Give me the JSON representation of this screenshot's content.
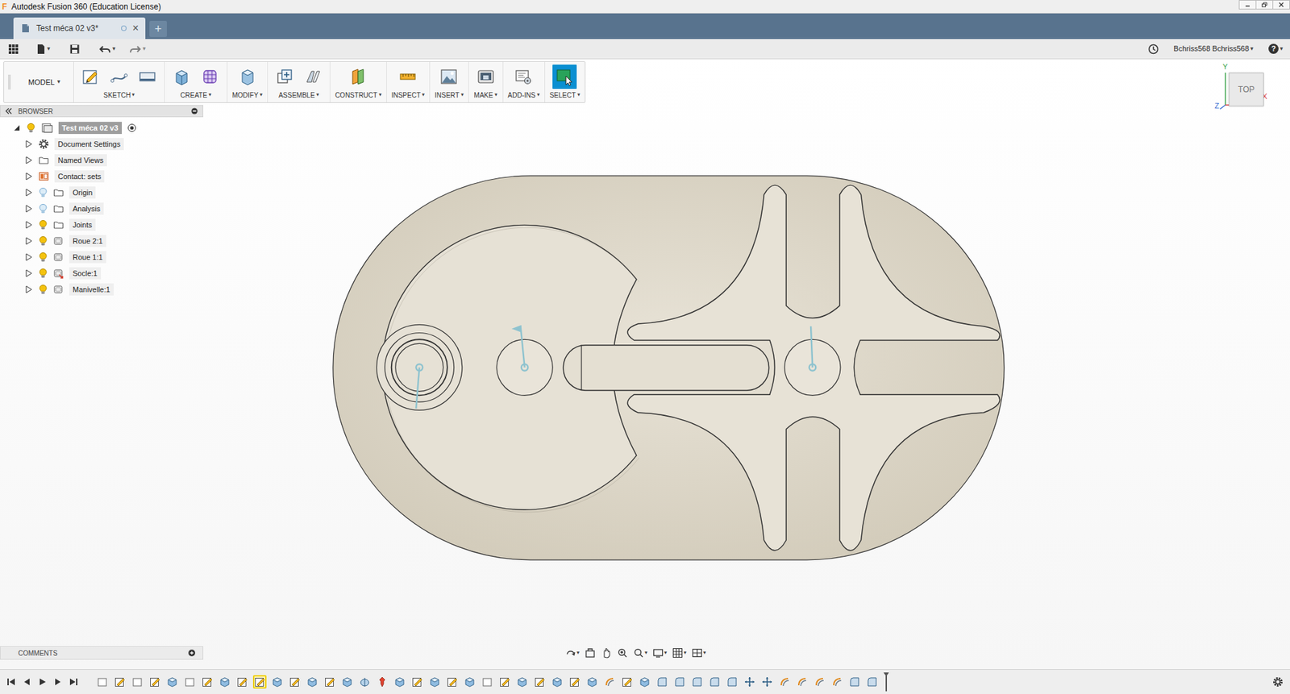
{
  "window": {
    "title": "Autodesk Fusion 360 (Education License)",
    "app_letter": "F"
  },
  "glyphs": {
    "dropdown": "▾"
  },
  "document_tab": {
    "label": "Test méca 02 v3*",
    "close": "×",
    "selected": true
  },
  "new_tab": "+",
  "quick_access": {
    "user": "Bchriss568 Bchriss568",
    "help": "?"
  },
  "toolbar": {
    "workspace": "MODEL",
    "groups": [
      {
        "label": "SKETCH",
        "selected": false
      },
      {
        "label": "CREATE",
        "selected": false
      },
      {
        "label": "MODIFY",
        "selected": false
      },
      {
        "label": "ASSEMBLE",
        "selected": false
      },
      {
        "label": "CONSTRUCT",
        "selected": false
      },
      {
        "label": "INSPECT",
        "selected": false
      },
      {
        "label": "INSERT",
        "selected": false
      },
      {
        "label": "MAKE",
        "selected": false
      },
      {
        "label": "ADD-INS",
        "selected": false
      },
      {
        "label": "SELECT",
        "selected": true
      }
    ]
  },
  "browser": {
    "header": "BROWSER",
    "items": [
      {
        "label": "Test méca 02 v3",
        "depth": 0,
        "expanded": true,
        "icon": "document",
        "bulb": "on",
        "selected": true,
        "active": true
      },
      {
        "label": "Document Settings",
        "depth": 1,
        "expanded": false,
        "icon": "settings",
        "bulb": "none",
        "selected": false,
        "active": false
      },
      {
        "label": "Named Views",
        "depth": 1,
        "expanded": false,
        "icon": "folder",
        "bulb": "none",
        "selected": false,
        "active": false
      },
      {
        "label": "Contact: sets",
        "depth": 1,
        "expanded": false,
        "icon": "contact",
        "bulb": "none",
        "selected": false,
        "active": false
      },
      {
        "label": "Origin",
        "depth": 1,
        "expanded": false,
        "icon": "folder",
        "bulb": "off",
        "selected": false,
        "active": false
      },
      {
        "label": "Analysis",
        "depth": 1,
        "expanded": false,
        "icon": "folder",
        "bulb": "off",
        "selected": false,
        "active": false
      },
      {
        "label": "Joints",
        "depth": 1,
        "expanded": false,
        "icon": "folder",
        "bulb": "on",
        "selected": false,
        "active": false
      },
      {
        "label": "Roue 2:1",
        "depth": 1,
        "expanded": false,
        "icon": "component",
        "bulb": "on",
        "selected": false,
        "active": false
      },
      {
        "label": "Roue 1:1",
        "depth": 1,
        "expanded": false,
        "icon": "component",
        "bulb": "on",
        "selected": false,
        "active": false
      },
      {
        "label": "Socle:1",
        "depth": 1,
        "expanded": false,
        "icon": "component-linked",
        "bulb": "on",
        "selected": false,
        "active": false
      },
      {
        "label": "Manivelle:1",
        "depth": 1,
        "expanded": false,
        "icon": "component",
        "bulb": "on",
        "selected": false,
        "active": false
      }
    ]
  },
  "viewcube": {
    "face": "TOP",
    "axes": [
      {
        "label": "Y",
        "color": "#3aa34a"
      },
      {
        "label": "X",
        "color": "#d9383a"
      },
      {
        "label": "Z",
        "color": "#3b6fd1"
      }
    ]
  },
  "comments": {
    "label": "COMMENTS"
  },
  "timeline": {
    "features": [
      {
        "kind": "body",
        "selected": false
      },
      {
        "kind": "sketch",
        "selected": false
      },
      {
        "kind": "body",
        "selected": false
      },
      {
        "kind": "sketch",
        "selected": false
      },
      {
        "kind": "extrude",
        "selected": false
      },
      {
        "kind": "body",
        "selected": false
      },
      {
        "kind": "sketch",
        "selected": false
      },
      {
        "kind": "extrude",
        "selected": false
      },
      {
        "kind": "sketch",
        "selected": false
      },
      {
        "kind": "sketch",
        "selected": true
      },
      {
        "kind": "extrude",
        "selected": false
      },
      {
        "kind": "sketch",
        "selected": false
      },
      {
        "kind": "extrude",
        "selected": false
      },
      {
        "kind": "sketch",
        "selected": false
      },
      {
        "kind": "extrude",
        "selected": false
      },
      {
        "kind": "revolve",
        "selected": false
      },
      {
        "kind": "joint",
        "selected": false
      },
      {
        "kind": "extrude",
        "selected": false
      },
      {
        "kind": "sketch",
        "selected": false
      },
      {
        "kind": "extrude",
        "selected": false
      },
      {
        "kind": "sketch",
        "selected": false
      },
      {
        "kind": "extrude",
        "selected": false
      },
      {
        "kind": "body",
        "selected": false
      },
      {
        "kind": "sketch",
        "selected": false
      },
      {
        "kind": "extrude",
        "selected": false
      },
      {
        "kind": "sketch",
        "selected": false
      },
      {
        "kind": "extrude",
        "selected": false
      },
      {
        "kind": "sketch",
        "selected": false
      },
      {
        "kind": "extrude",
        "selected": false
      },
      {
        "kind": "motion",
        "selected": false
      },
      {
        "kind": "sketch",
        "selected": false
      },
      {
        "kind": "extrude",
        "selected": false
      },
      {
        "kind": "fillet",
        "selected": false
      },
      {
        "kind": "fillet",
        "selected": false
      },
      {
        "kind": "fillet",
        "selected": false
      },
      {
        "kind": "fillet",
        "selected": false
      },
      {
        "kind": "fillet",
        "selected": false
      },
      {
        "kind": "move",
        "selected": false
      },
      {
        "kind": "move",
        "selected": false
      },
      {
        "kind": "motion",
        "selected": false
      },
      {
        "kind": "motion",
        "selected": false
      },
      {
        "kind": "motion",
        "selected": false
      },
      {
        "kind": "motion",
        "selected": false
      },
      {
        "kind": "fillet",
        "selected": false
      },
      {
        "kind": "fillet",
        "selected": false
      }
    ]
  }
}
